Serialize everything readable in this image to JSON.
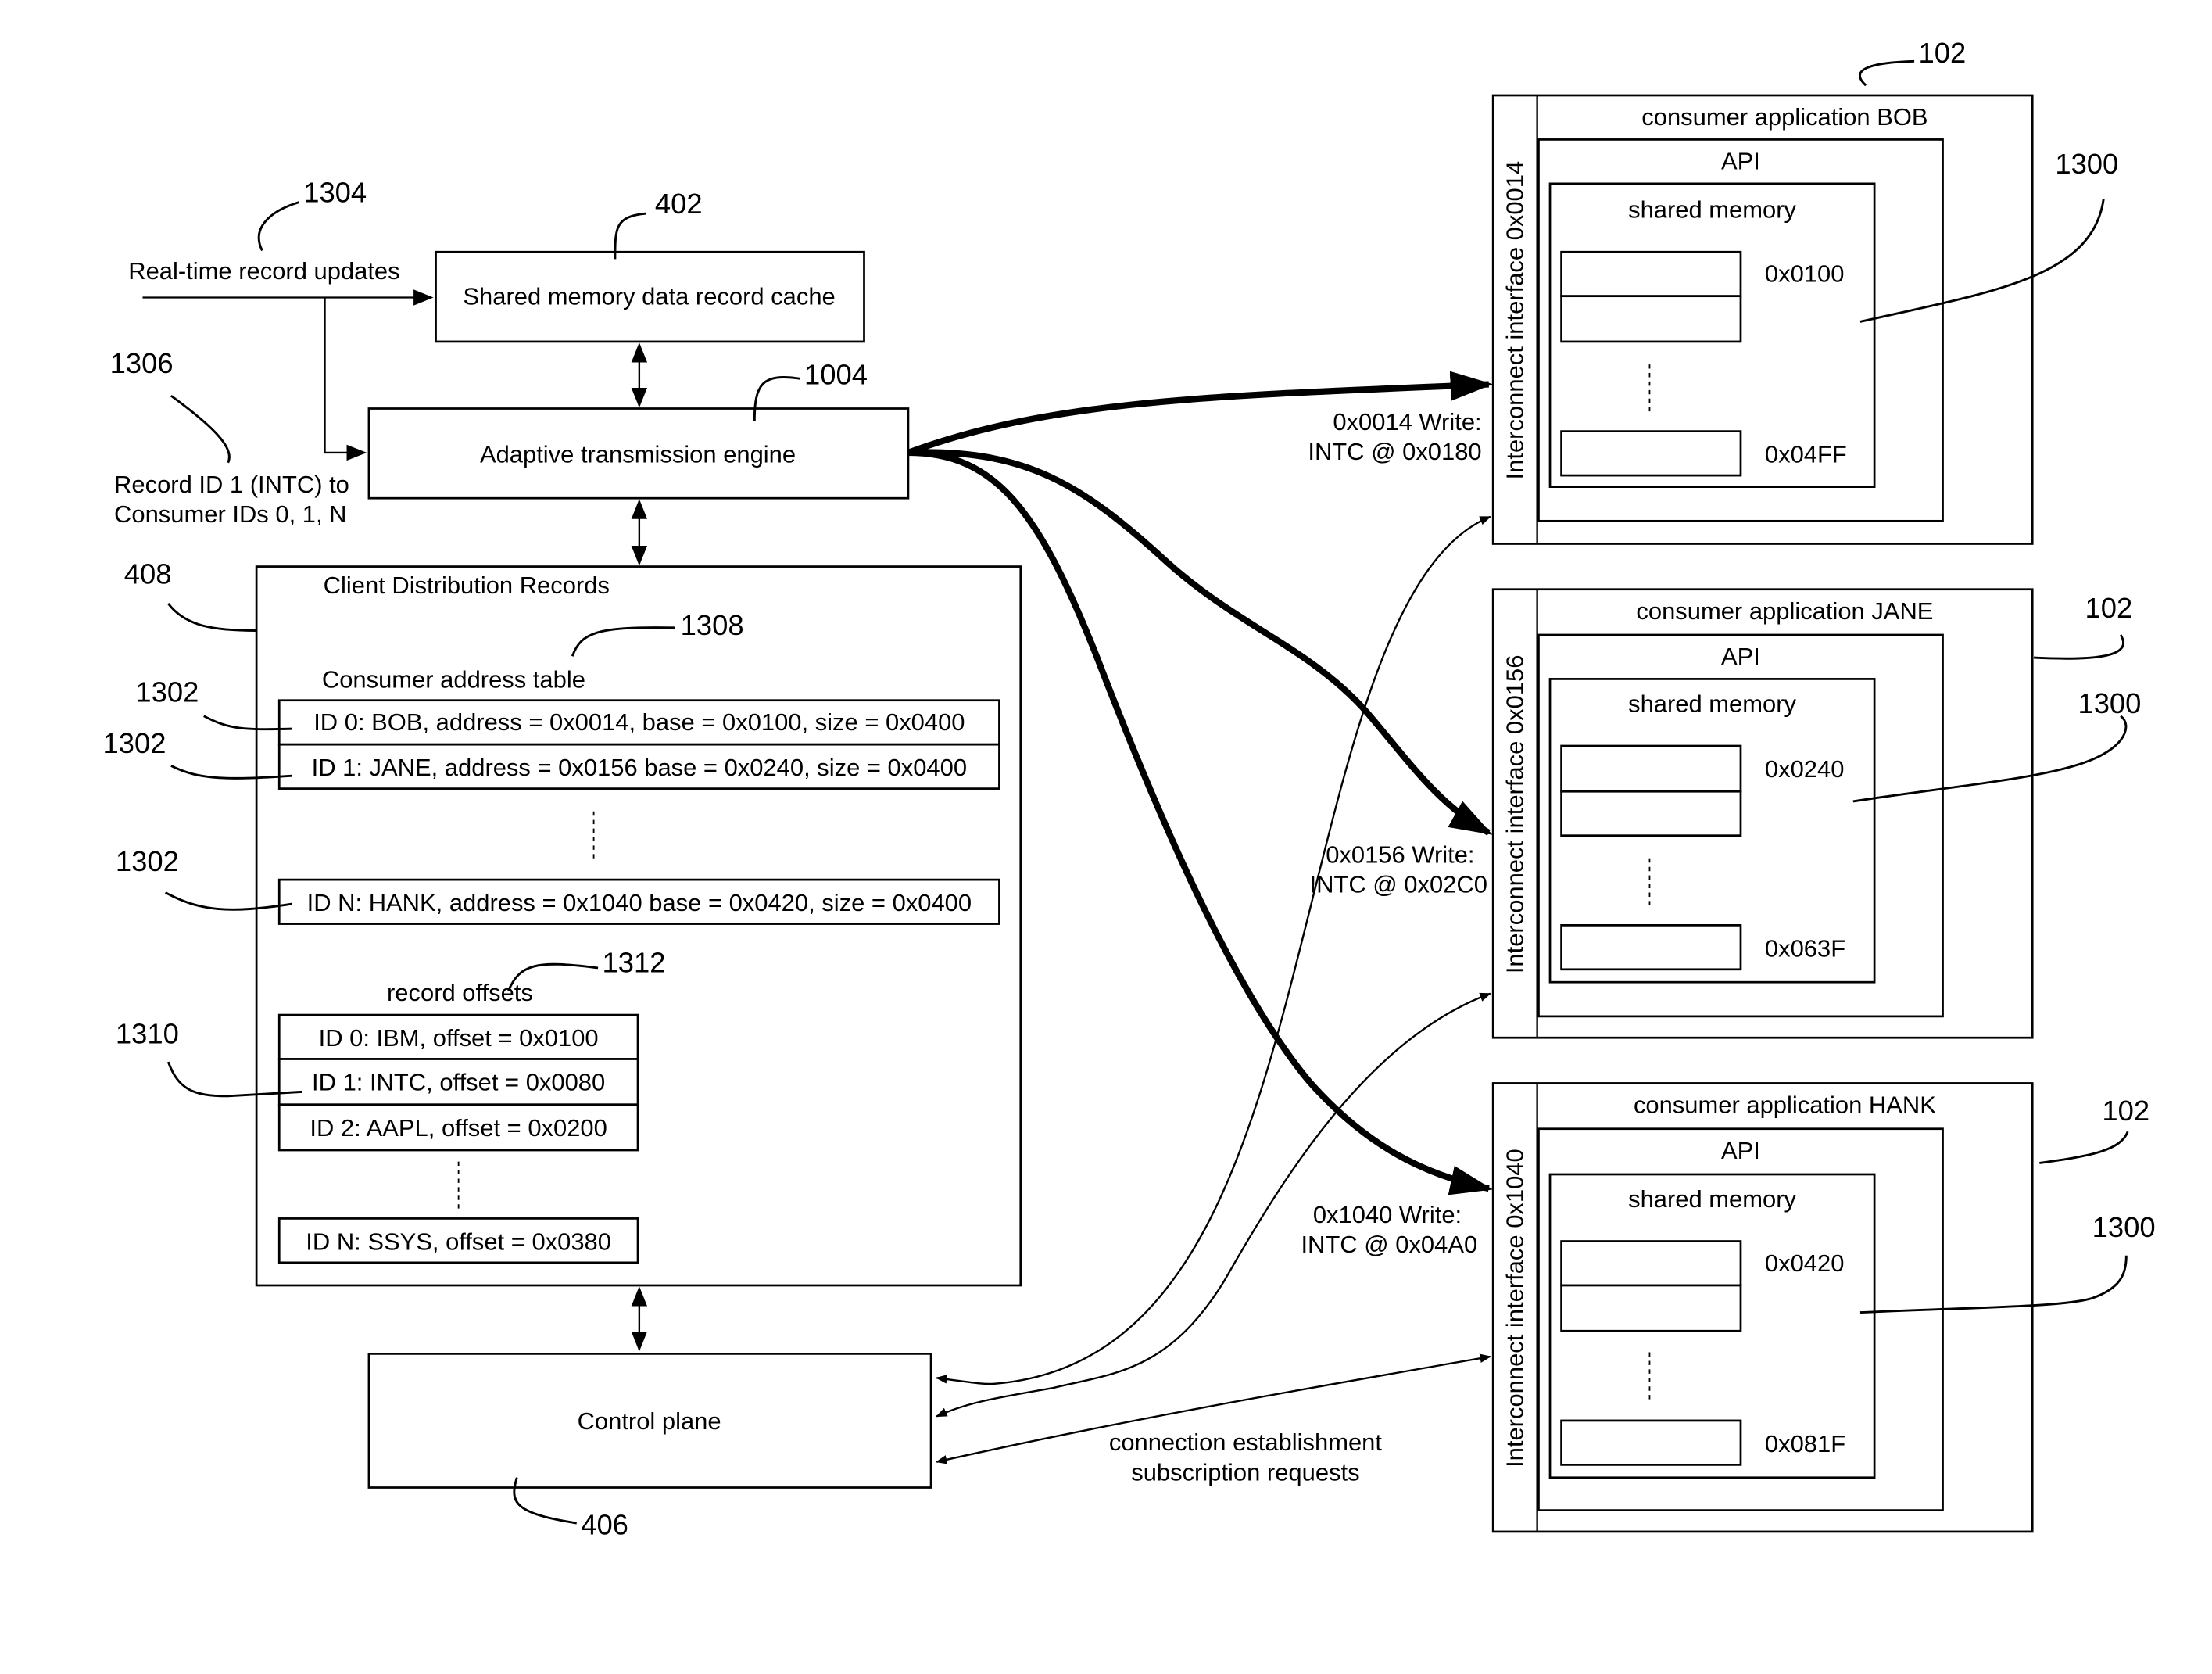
{
  "diagram": {
    "inputs": {
      "realtime_updates": "Real-time record updates",
      "record_routing_line1": "Record ID 1 (INTC) to",
      "record_routing_line2": "Consumer IDs 0, 1, N"
    },
    "blocks": {
      "cache": "Shared memory data record cache",
      "engine": "Adaptive transmission engine",
      "control_plane": "Control plane"
    },
    "client_distribution": {
      "title": "Client Distribution Records",
      "address_table_title": "Consumer address table",
      "address_rows": [
        "ID 0: BOB, address = 0x0014, base = 0x0100, size = 0x0400",
        "ID 1: JANE, address = 0x0156 base = 0x0240, size = 0x0400",
        "ID N: HANK, address = 0x1040 base = 0x0420, size = 0x0400"
      ],
      "offsets_title": "record offsets",
      "offset_rows": [
        "ID 0: IBM, offset = 0x0100",
        "ID 1: INTC, offset = 0x0080",
        "ID 2: AAPL, offset = 0x0200",
        "ID N: SSYS, offset = 0x0380"
      ]
    },
    "consumers": [
      {
        "title": "consumer application BOB",
        "interface": "Interconnect interface 0x0014",
        "api": "API",
        "shared_memory": "shared memory",
        "start_addr": "0x0100",
        "end_addr": "0x04FF",
        "write_line1": "0x0014 Write:",
        "write_line2": "INTC @ 0x0180"
      },
      {
        "title": "consumer application JANE",
        "interface": "Interconnect interface 0x0156",
        "api": "API",
        "shared_memory": "shared memory",
        "start_addr": "0x0240",
        "end_addr": "0x063F",
        "write_line1": "0x0156 Write:",
        "write_line2": "INTC @ 0x02C0"
      },
      {
        "title": "consumer application HANK",
        "interface": "Interconnect interface 0x1040",
        "api": "API",
        "shared_memory": "shared memory",
        "start_addr": "0x0420",
        "end_addr": "0x081F",
        "write_line1": "0x1040 Write:",
        "write_line2": "INTC @ 0x04A0"
      }
    ],
    "control_caption_line1": "connection establishment",
    "control_caption_line2": "subscription requests",
    "reference_numerals": {
      "r102_bob": "102",
      "r102_jane": "102",
      "r102_hank": "102",
      "r1300_bob": "1300",
      "r1300_jane": "1300",
      "r1300_hank": "1300",
      "r1304": "1304",
      "r402": "402",
      "r1004": "1004",
      "r1306": "1306",
      "r408": "408",
      "r1308": "1308",
      "r1302_a": "1302",
      "r1302_b": "1302",
      "r1302_c": "1302",
      "r1312": "1312",
      "r1310": "1310",
      "r406": "406"
    }
  }
}
